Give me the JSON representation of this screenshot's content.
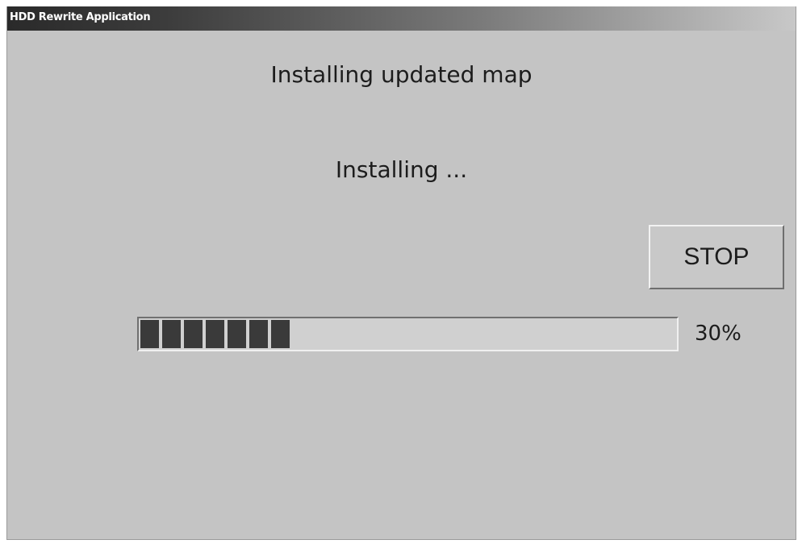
{
  "window": {
    "title": "HDD Rewrite Application"
  },
  "main": {
    "heading": "Installing updated map",
    "status": "Installing ..."
  },
  "buttons": {
    "stop_label": "STOP"
  },
  "progress": {
    "value": 30,
    "label": "30%",
    "total_blocks": 24
  },
  "colors": {
    "background": "#c4c4c4",
    "progress_fill": "#3a3a3a"
  }
}
